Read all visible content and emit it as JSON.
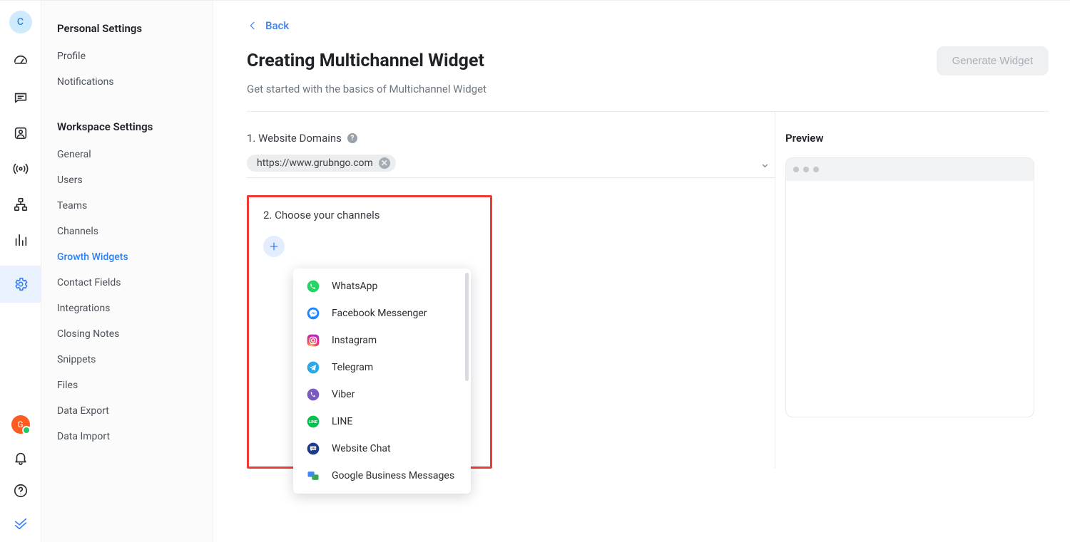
{
  "rail": {
    "avatar_top": "C",
    "avatar_bottom": "G"
  },
  "sidebar": {
    "section1_title": "Personal Settings",
    "section1_items": [
      "Profile",
      "Notifications"
    ],
    "section2_title": "Workspace Settings",
    "section2_items": [
      "General",
      "Users",
      "Teams",
      "Channels",
      "Growth Widgets",
      "Contact Fields",
      "Integrations",
      "Closing Notes",
      "Snippets",
      "Files",
      "Data Export",
      "Data Import"
    ],
    "active_index": 4
  },
  "header": {
    "back_label": "Back",
    "title": "Creating Multichannel Widget",
    "subtitle": "Get started with the basics of Multichannel Widget",
    "generate_btn": "Generate Widget"
  },
  "step1": {
    "label": "1. Website Domains",
    "domain_chip": "https://www.grubngo.com"
  },
  "step2": {
    "label": "2. Choose your channels",
    "options": [
      {
        "name": "WhatsApp",
        "color": "#25d366"
      },
      {
        "name": "Facebook Messenger",
        "color": "#1e88ff"
      },
      {
        "name": "Instagram",
        "color": "instagram"
      },
      {
        "name": "Telegram",
        "color": "#2aa7e8"
      },
      {
        "name": "Viber",
        "color": "#7a5bbd"
      },
      {
        "name": "LINE",
        "color": "#06c152"
      },
      {
        "name": "Website Chat",
        "color": "#1e3a8a"
      },
      {
        "name": "Google Business Messages",
        "color": "gbm"
      }
    ]
  },
  "preview": {
    "label": "Preview"
  }
}
